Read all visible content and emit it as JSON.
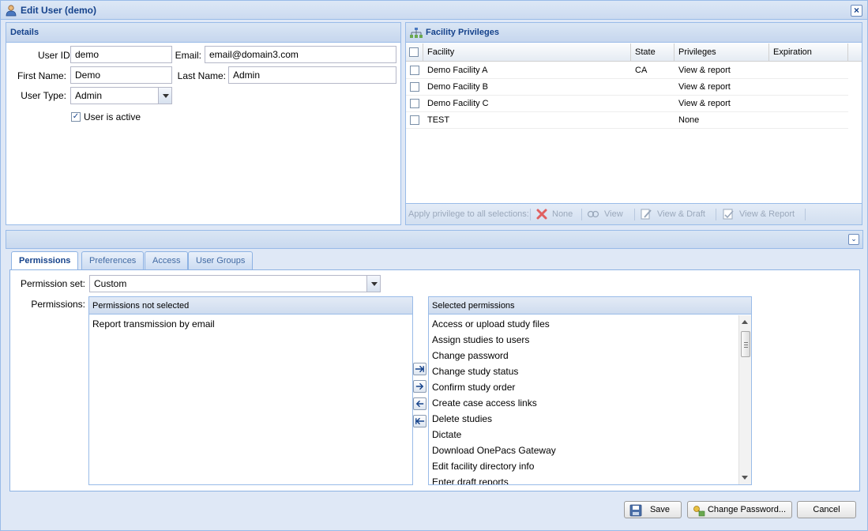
{
  "window": {
    "title": "Edit User (demo)"
  },
  "details": {
    "header": "Details",
    "user_id_label": "User ID:",
    "user_id_value": "demo",
    "email_label": "Email:",
    "email_value": "email@domain3.com",
    "first_name_label": "First Name:",
    "first_name_value": "Demo",
    "last_name_label": "Last Name:",
    "last_name_value": "Admin",
    "user_type_label": "User Type:",
    "user_type_value": "Admin",
    "active_label": "User is active",
    "active_checked": true
  },
  "facility": {
    "header": "Facility Privileges",
    "columns": [
      "Facility",
      "State",
      "Privileges",
      "Expiration"
    ],
    "rows": [
      {
        "facility": "Demo Facility A",
        "state": "CA",
        "privileges": "View & report",
        "expiration": ""
      },
      {
        "facility": "Demo Facility B",
        "state": "",
        "privileges": "View & report",
        "expiration": ""
      },
      {
        "facility": "Demo Facility C",
        "state": "",
        "privileges": "View & report",
        "expiration": ""
      },
      {
        "facility": "TEST",
        "state": "",
        "privileges": "None",
        "expiration": ""
      }
    ],
    "toolbar": {
      "apply_label": "Apply privilege to all selections:",
      "none": "None",
      "view": "View",
      "view_draft": "View & Draft",
      "view_report": "View & Report"
    }
  },
  "tabs": [
    "Permissions",
    "Preferences",
    "Access",
    "User Groups"
  ],
  "permissions": {
    "set_label": "Permission set:",
    "set_value": "Custom",
    "permissions_label": "Permissions:",
    "not_selected_header": "Permissions not selected",
    "not_selected": [
      "Report transmission by email"
    ],
    "selected_header": "Selected permissions",
    "selected": [
      "Access or upload study files",
      "Assign studies to users",
      "Change password",
      "Change study status",
      "Confirm study order",
      "Create case access links",
      "Delete studies",
      "Dictate",
      "Download OnePacs Gateway",
      "Edit facility directory info",
      "Enter draft reports"
    ]
  },
  "footer": {
    "save": "Save",
    "change_password": "Change Password...",
    "cancel": "Cancel"
  }
}
